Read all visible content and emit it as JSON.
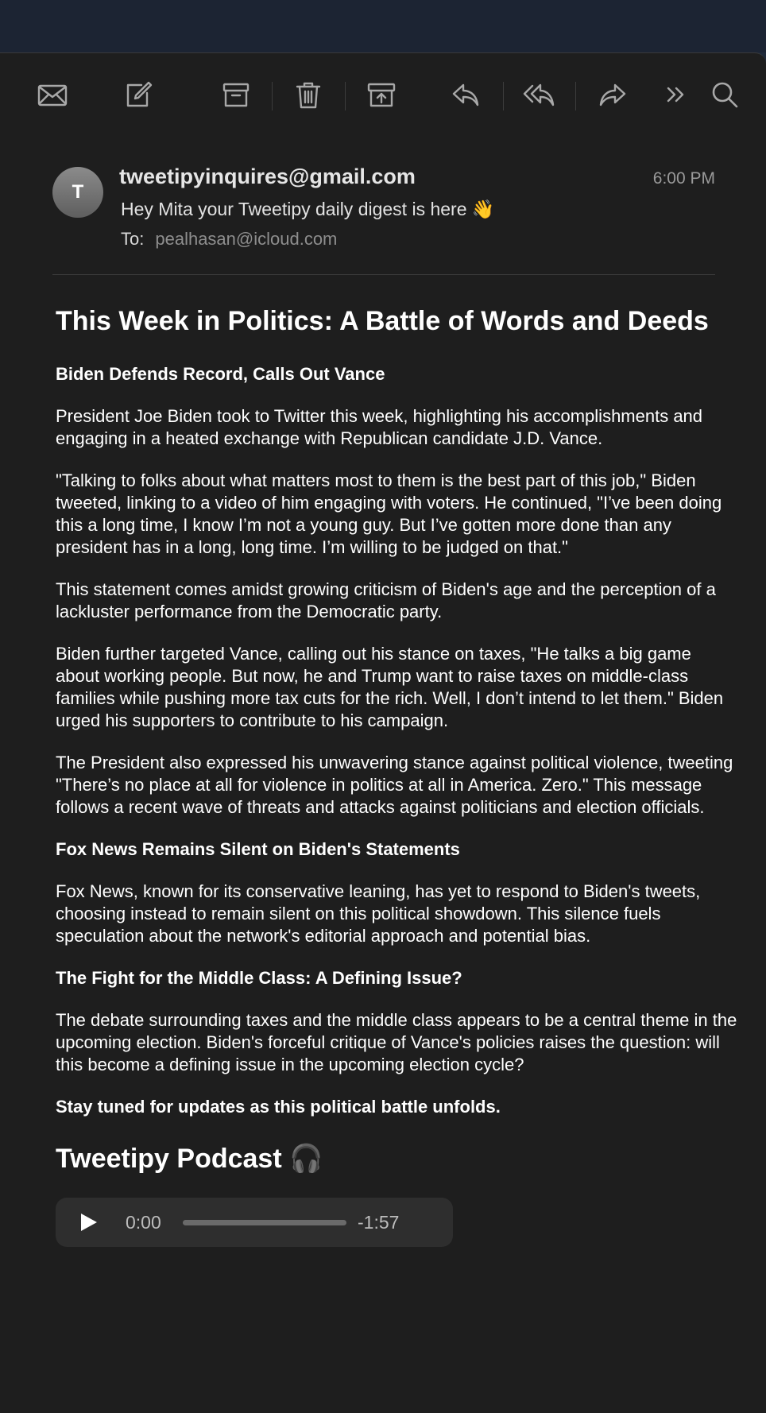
{
  "toolbar": {
    "icons": [
      "envelope-icon",
      "compose-icon",
      "archive-icon",
      "trash-icon",
      "move-to-junk-icon",
      "reply-icon",
      "reply-all-icon",
      "forward-icon",
      "more-icon",
      "search-icon"
    ]
  },
  "message": {
    "avatar_initial": "T",
    "sender": "tweetipyinquires@gmail.com",
    "time": "6:00 PM",
    "subject": "Hey Mita your Tweetipy daily digest is here 👋",
    "to_label": "To:",
    "to_address": "pealhasan@icloud.com"
  },
  "article": {
    "title": "This Week in Politics: A Battle of Words and Deeds",
    "section1_heading": "Biden Defends Record, Calls Out Vance",
    "p1": "President Joe Biden took to Twitter this week, highlighting his accomplishments and engaging in a heated exchange with Republican candidate J.D. Vance.",
    "p2": "\"Talking to folks about what matters most to them is the best part of this job,\" Biden tweeted, linking to a video of him engaging with voters. He continued, \"I’ve been doing this a long time, I know I’m not a young guy. But I’ve gotten more done than any president has in a long, long time. I’m willing to be judged on that.\"",
    "p3": "This statement comes amidst growing criticism of Biden's age and the perception of a lackluster performance from the Democratic party.",
    "p4": "Biden further targeted Vance, calling out his stance on taxes, \"He talks a big game about working people. But now, he and Trump want to raise taxes on middle-class families while pushing more tax cuts for the rich. Well, I don’t intend to let them.\" Biden urged his supporters to contribute to his campaign.",
    "p5": "The President also expressed his unwavering stance against political violence, tweeting \"There’s no place at all for violence in politics at all in America. Zero.\" This message follows a recent wave of threats and attacks against politicians and election officials.",
    "section2_heading": "Fox News Remains Silent on Biden's Statements",
    "p6": "Fox News, known for its conservative leaning, has yet to respond to Biden's tweets, choosing instead to remain silent on this political showdown. This silence fuels speculation about the network's editorial approach and potential bias.",
    "section3_heading": "The Fight for the Middle Class: A Defining Issue?",
    "p7": "The debate surrounding taxes and the middle class appears to be a central theme in the upcoming election. Biden's forceful critique of Vance's policies raises the question: will this become a defining issue in the upcoming election cycle?",
    "closing": "Stay tuned for updates as this political battle unfolds."
  },
  "podcast": {
    "title": "Tweetipy Podcast 🎧",
    "current_time": "0:00",
    "remaining_time": "-1:57",
    "progress": 0
  }
}
